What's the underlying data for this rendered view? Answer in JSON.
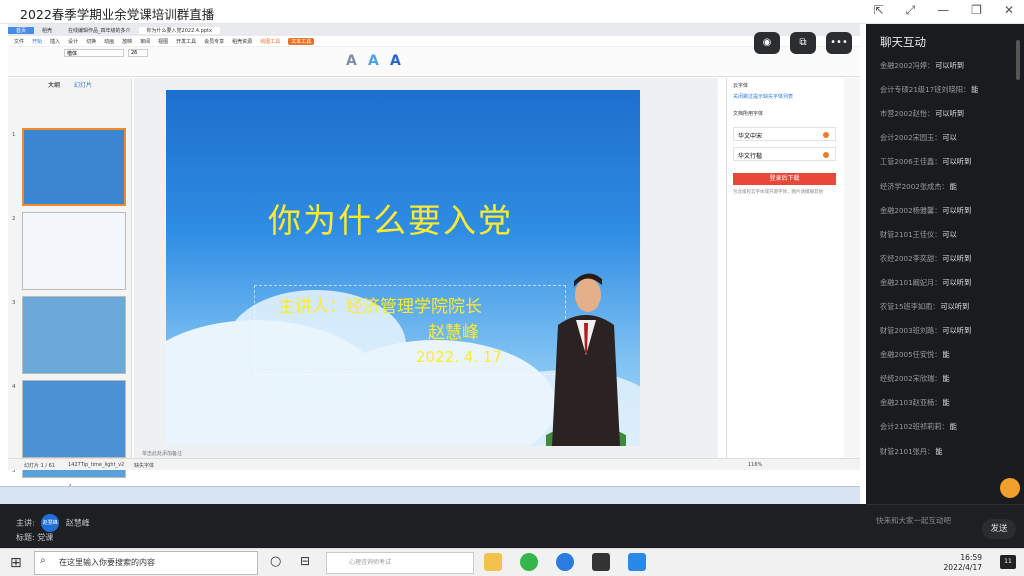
{
  "window": {
    "title": "2022春季学期业余党课培训群直播"
  },
  "ppt": {
    "doc_tab": "你为什么要入党2022.4.pptx",
    "home_tab": "首页",
    "tab2": "稻壳",
    "tab3": "在线编辑作品_四年级的多介",
    "menu": [
      "文件",
      "开始",
      "插入",
      "设计",
      "切换",
      "动画",
      "放映",
      "审阅",
      "视图",
      "开发工具",
      "会员专享",
      "稻壳资源",
      "绘图工具",
      "文本工具"
    ],
    "font_name": "楷体",
    "font_size": "26",
    "thumb_tabs": [
      "大纲",
      "幻灯片"
    ],
    "slide_title": "你为什么要入党",
    "slide_speaker": "主讲人：经济管理学院院长",
    "slide_name": "赵慧峰",
    "slide_date": "2022. 4. 17",
    "notes_placeholder": "单击此处添加备注",
    "status": {
      "page": "幻灯片 1 / 61",
      "theme": "1427Tip_time_light_v2",
      "font_missing": "缺失字体",
      "zoom": "116%"
    },
    "taskpane": {
      "title": "云字体",
      "link": "关闭跳过提示缺失字体列表",
      "subtitle": "文档所用字体",
      "fonts": [
        "华文中宋",
        "华文行楷"
      ],
      "download": "登录后下载",
      "tip": "包含版权云字体或开源字体，图片请模糊其他"
    }
  },
  "chat": {
    "title": "聊天互动",
    "messages": [
      {
        "user": "金融2002冯婷：",
        "text": "可以听到"
      },
      {
        "user": "会计专硕21级17班刘晓阳：",
        "text": "能"
      },
      {
        "user": "市营2002赵怡：",
        "text": "可以听到"
      },
      {
        "user": "会计2002宋园玉：",
        "text": "可以"
      },
      {
        "user": "工管2006王佳鑫：",
        "text": "可以听到"
      },
      {
        "user": "经济学2002张成杰：",
        "text": "能"
      },
      {
        "user": "金融2002杨雅馨：",
        "text": "可以听到"
      },
      {
        "user": "财管2101王佳仪：",
        "text": "可以"
      },
      {
        "user": "农经2002李奕甜：",
        "text": "可以听到"
      },
      {
        "user": "金融2101阚妃月：",
        "text": "可以听到"
      },
      {
        "user": "农管15班李如雨：",
        "text": "可以听到"
      },
      {
        "user": "财管2003班刘路：",
        "text": "可以听到"
      },
      {
        "user": "金融2005任安悦：",
        "text": "能"
      },
      {
        "user": "经统2002宋欣瑞：",
        "text": "能"
      },
      {
        "user": "金融2103赵亚楠：",
        "text": "能"
      },
      {
        "user": "会计2102班祁莉莉：",
        "text": "能"
      },
      {
        "user": "财管2101张丹：",
        "text": "能"
      }
    ],
    "input_placeholder": "快来和大家一起互动吧",
    "send": "发送"
  },
  "live": {
    "host_label": "主讲:",
    "host_name": "赵慧峰",
    "avatar_text": "赵慧峰",
    "topic_label": "标题:",
    "topic": "党课"
  },
  "taskbar": {
    "search_placeholder": "在这里输入你要搜索的内容",
    "edge_placeholder": "心理咨询师考试",
    "time": "16:59",
    "date": "2022/4/17",
    "notif": "11"
  }
}
